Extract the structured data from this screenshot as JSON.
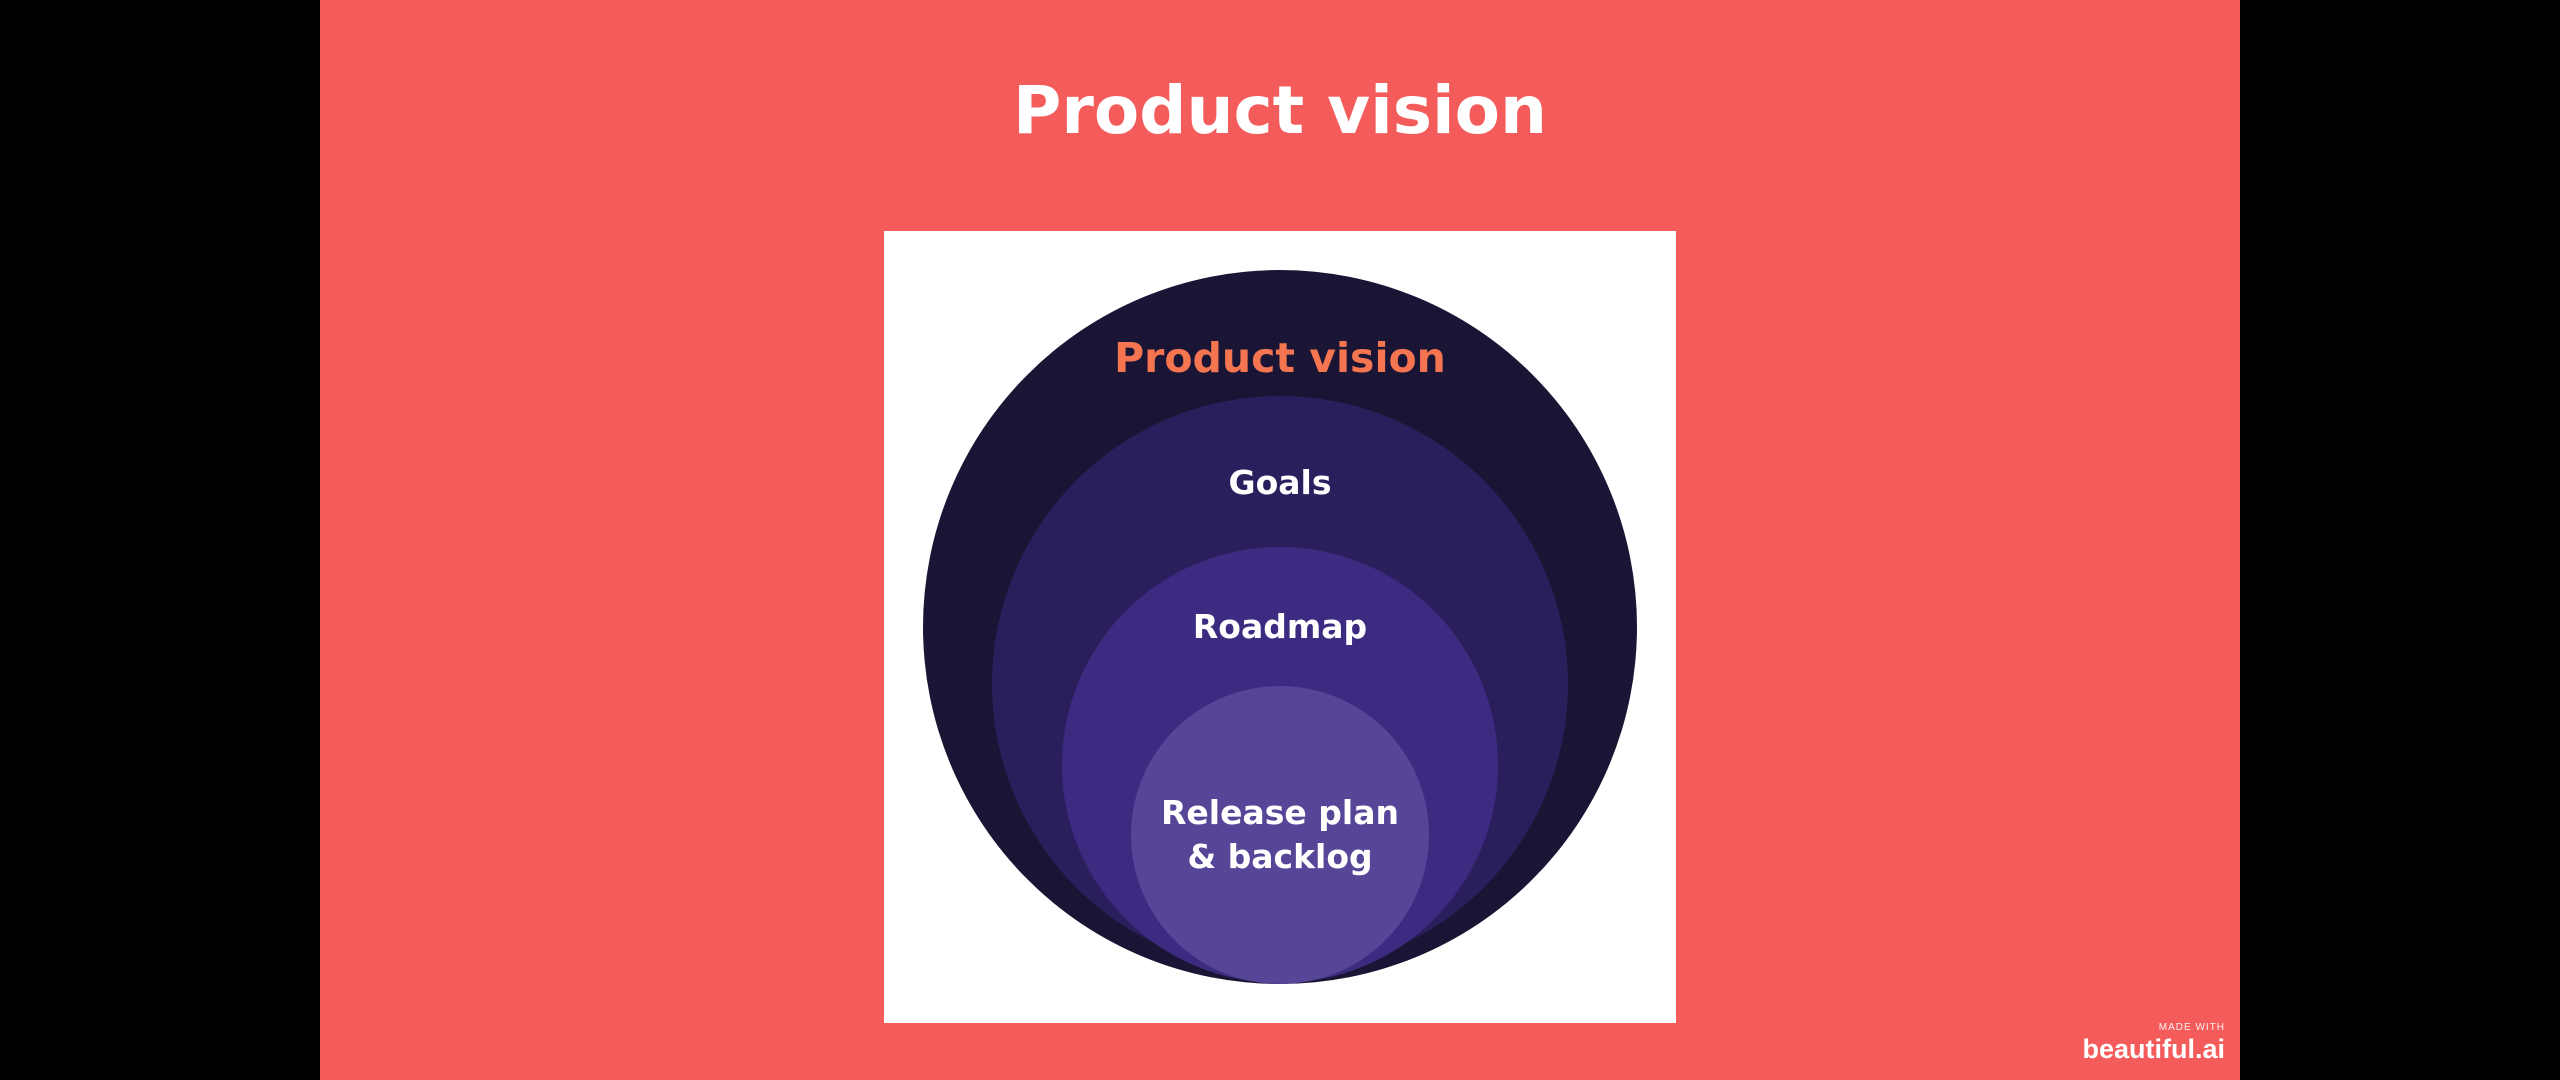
{
  "slide": {
    "title": "Product vision"
  },
  "diagram": {
    "layers": [
      {
        "label": "Product vision",
        "color": "#1b1535",
        "label_color": "#f4754f"
      },
      {
        "label": "Goals",
        "color": "#2a1f5c",
        "label_color": "#ffffff"
      },
      {
        "label": "Roadmap",
        "color": "#3c2b80",
        "label_color": "#ffffff"
      },
      {
        "label_lines": [
          "Release plan",
          "& backlog"
        ],
        "color": "#574597",
        "label_color": "#ffffff"
      }
    ]
  },
  "colors": {
    "slide_background": "#f45c5c",
    "card_background": "#ffffff"
  },
  "badge": {
    "made_with": "MADE WITH",
    "brand": "beautiful.ai"
  }
}
